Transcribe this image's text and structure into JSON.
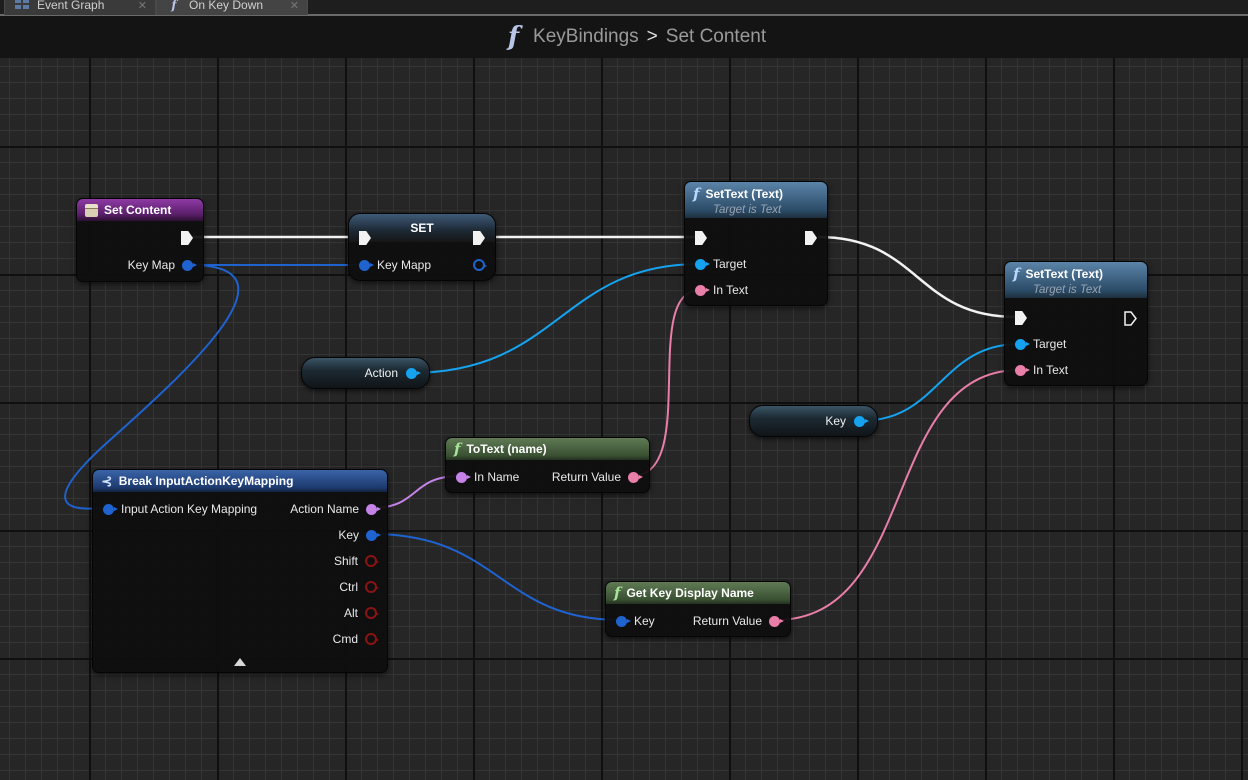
{
  "tabs": [
    {
      "label": "Event Graph",
      "icon": "event-graph-icon",
      "active": false
    },
    {
      "label": "On Key Down",
      "icon": "function-icon",
      "active": true
    }
  ],
  "breadcrumb": {
    "icon": "function-icon",
    "glyph": "f",
    "items": [
      "KeyBindings",
      "Set Content"
    ],
    "separator": ">"
  },
  "nodes": {
    "set_content": {
      "title": "Set Content",
      "type": "event",
      "pins_out": [
        "Key Map"
      ]
    },
    "set": {
      "title": "SET",
      "type": "variable-set",
      "pins_in": [
        "Key Mapp"
      ]
    },
    "settext_1": {
      "title": "SetText (Text)",
      "subtitle": "Target is Text",
      "type": "function",
      "pins_in": [
        "Target",
        "In Text"
      ]
    },
    "settext_2": {
      "title": "SetText (Text)",
      "subtitle": "Target is Text",
      "type": "function",
      "pins_in": [
        "Target",
        "In Text"
      ]
    },
    "action_var": {
      "label": "Action",
      "type": "variable-get"
    },
    "key_var": {
      "label": "Key",
      "type": "variable-get"
    },
    "totext": {
      "title": "ToText (name)",
      "type": "pure-function",
      "pins_in": [
        "In Name"
      ],
      "pins_out": [
        "Return Value"
      ]
    },
    "break_mapping": {
      "title": "Break InputActionKeyMapping",
      "type": "break-struct",
      "pins_in": [
        "Input Action Key Mapping"
      ],
      "pins_out": [
        "Action Name",
        "Key",
        "Shift",
        "Ctrl",
        "Alt",
        "Cmd"
      ]
    },
    "get_key_display_name": {
      "title": "Get Key Display Name",
      "type": "pure-function",
      "pins_in": [
        "Key"
      ],
      "pins_out": [
        "Return Value"
      ]
    }
  },
  "colors": {
    "exec_wire": "#f2f2f2",
    "struct_wire": "#1f63d0",
    "object_wire": "#15a2ee",
    "text_wire": "#e97ea8",
    "name_wire": "#c583e8",
    "bool_pin": "#8a1414",
    "event_header": "#8e3aa4",
    "function_header": "#5a84a8",
    "pure_function_header": "#5f7a55",
    "break_header": "#3a64a8"
  }
}
